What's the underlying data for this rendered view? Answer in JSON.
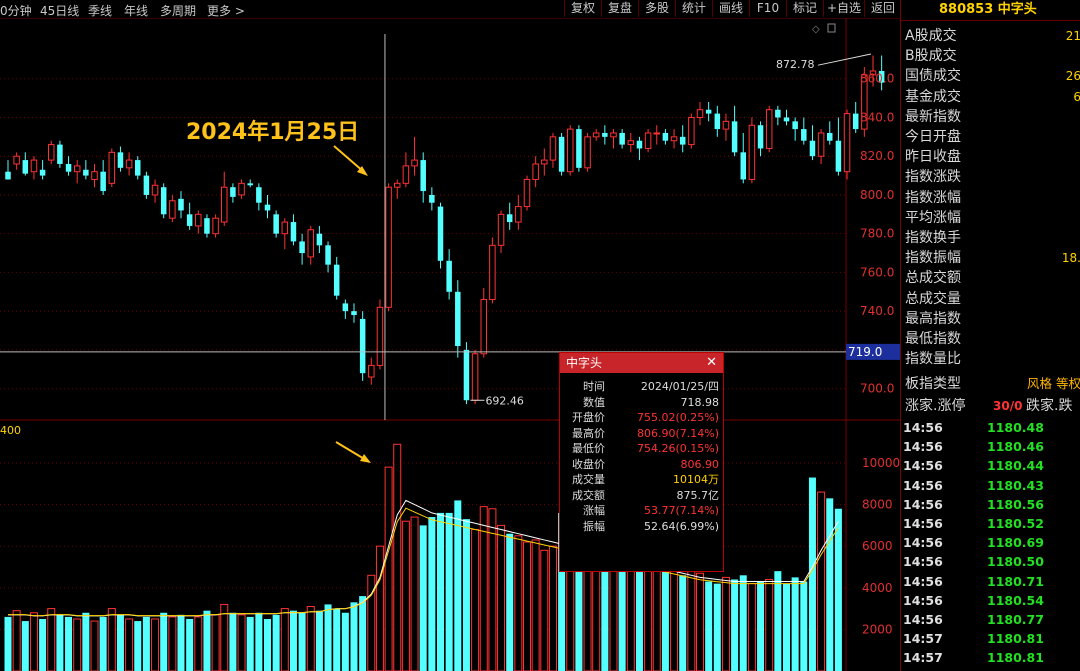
{
  "toolbar": {
    "left_items": [
      "0分钟",
      "45日线",
      "季线",
      "年线",
      "多周期",
      "更多 >"
    ],
    "right_buttons": [
      "复权",
      "复盘",
      "多股",
      "统计",
      "画线",
      "F10",
      "标记",
      "+自选",
      "返回"
    ]
  },
  "chart": {
    "price_ticks": [
      "860.0",
      "840.0",
      "820.0",
      "800.0",
      "780.0",
      "760.0",
      "740.0",
      "720.0",
      "700.0"
    ],
    "volume_ticks": [
      "10000",
      "8000",
      "6000",
      "4000",
      "2000"
    ],
    "crosshair_value": "719.0",
    "max_label": "872.78",
    "min_label": "692.46",
    "annotation": "2024年1月25日",
    "volume_header": "400"
  },
  "popup": {
    "title": "中字头",
    "close": "✕",
    "rows": [
      {
        "label": "时间",
        "value": "2024/01/25/四",
        "color": "#dddddd"
      },
      {
        "label": "数值",
        "value": "718.98",
        "color": "#dddddd"
      },
      {
        "label": "开盘价",
        "value": "755.02(0.25%)",
        "color": "#ff3333"
      },
      {
        "label": "最高价",
        "value": "806.90(7.14%)",
        "color": "#ff3333"
      },
      {
        "label": "最低价",
        "value": "754.26(0.15%)",
        "color": "#ff3333"
      },
      {
        "label": "收盘价",
        "value": "806.90",
        "color": "#ff3333"
      },
      {
        "label": "成交量",
        "value": "10104万",
        "color": "#ffd200"
      },
      {
        "label": "成交额",
        "value": "875.7亿",
        "color": "#dddddd"
      },
      {
        "label": "涨幅",
        "value": "53.77(7.14%)",
        "color": "#ff3333"
      },
      {
        "label": "振幅",
        "value": "52.64(6.99%)",
        "color": "#dddddd"
      }
    ]
  },
  "side": {
    "header": "880853 中字头",
    "info": [
      {
        "label": "A股成交",
        "value": "21"
      },
      {
        "label": "B股成交",
        "value": ""
      },
      {
        "label": "国债成交",
        "value": "26"
      },
      {
        "label": "基金成交",
        "value": "6"
      },
      {
        "label": "最新指数",
        "value": ""
      },
      {
        "label": "今日开盘",
        "value": ""
      },
      {
        "label": "昨日收盘",
        "value": ""
      },
      {
        "label": "指数涨跌",
        "value": ""
      },
      {
        "label": "指数涨幅",
        "value": ""
      },
      {
        "label": "平均涨幅",
        "value": ""
      },
      {
        "label": "指数换手",
        "value": ""
      },
      {
        "label": "指数振幅",
        "value": "18."
      },
      {
        "label": "总成交额",
        "value": ""
      },
      {
        "label": "总成交量",
        "value": ""
      },
      {
        "label": "最高指数",
        "value": ""
      },
      {
        "label": "最低指数",
        "value": ""
      },
      {
        "label": "指数量比",
        "value": ""
      }
    ],
    "board_type_label": "板指类型",
    "board_type_value": "风格 等权",
    "limit_label": "涨家.涨停",
    "limit_value": "30/0",
    "limit_right": "跌家.跌",
    "ticks": [
      {
        "time": "14:56",
        "price": "1180.48"
      },
      {
        "time": "14:56",
        "price": "1180.46"
      },
      {
        "time": "14:56",
        "price": "1180.44"
      },
      {
        "time": "14:56",
        "price": "1180.43"
      },
      {
        "time": "14:56",
        "price": "1180.56"
      },
      {
        "time": "14:56",
        "price": "1180.52"
      },
      {
        "time": "14:56",
        "price": "1180.69"
      },
      {
        "time": "14:56",
        "price": "1180.50"
      },
      {
        "time": "14:56",
        "price": "1180.71"
      },
      {
        "time": "14:56",
        "price": "1180.54"
      },
      {
        "time": "14:56",
        "price": "1180.77"
      },
      {
        "time": "14:57",
        "price": "1180.81"
      },
      {
        "time": "14:57",
        "price": "1180.81"
      }
    ]
  },
  "chart_data": {
    "type": "candlestick",
    "ylim": [
      690,
      880
    ],
    "vol_ylim": [
      0,
      11200
    ],
    "candles": [
      [
        812,
        818,
        808,
        808
      ],
      [
        816,
        822,
        813,
        820
      ],
      [
        818,
        822,
        810,
        811
      ],
      [
        812,
        820,
        808,
        818
      ],
      [
        813,
        818,
        808,
        810
      ],
      [
        818,
        828,
        816,
        826
      ],
      [
        826,
        828,
        814,
        816
      ],
      [
        816,
        820,
        810,
        812
      ],
      [
        812,
        818,
        806,
        815
      ],
      [
        813,
        818,
        808,
        810
      ],
      [
        808,
        816,
        804,
        812
      ],
      [
        812,
        818,
        800,
        802
      ],
      [
        806,
        824,
        804,
        822
      ],
      [
        822,
        825,
        812,
        814
      ],
      [
        814,
        822,
        810,
        818
      ],
      [
        818,
        820,
        808,
        810
      ],
      [
        810,
        812,
        798,
        800
      ],
      [
        800,
        808,
        796,
        805
      ],
      [
        804,
        806,
        788,
        790
      ],
      [
        788,
        800,
        786,
        797
      ],
      [
        798,
        802,
        788,
        792
      ],
      [
        790,
        796,
        782,
        784
      ],
      [
        784,
        792,
        780,
        790
      ],
      [
        788,
        790,
        778,
        780
      ],
      [
        780,
        790,
        778,
        788
      ],
      [
        786,
        812,
        784,
        804
      ],
      [
        804,
        806,
        796,
        799
      ],
      [
        800,
        808,
        798,
        806
      ],
      [
        806,
        808,
        804,
        805
      ],
      [
        804,
        806,
        792,
        796
      ],
      [
        795,
        800,
        788,
        792
      ],
      [
        790,
        792,
        778,
        780
      ],
      [
        780,
        788,
        772,
        786
      ],
      [
        786,
        790,
        774,
        776
      ],
      [
        776,
        780,
        764,
        770
      ],
      [
        768,
        784,
        764,
        782
      ],
      [
        780,
        784,
        770,
        774
      ],
      [
        774,
        776,
        760,
        764
      ],
      [
        764,
        768,
        746,
        748
      ],
      [
        744,
        746,
        736,
        740
      ],
      [
        740,
        744,
        734,
        738
      ],
      [
        736,
        740,
        704,
        708
      ],
      [
        706,
        716,
        702,
        712
      ],
      [
        712,
        746,
        710,
        742
      ],
      [
        742,
        806,
        740,
        804
      ],
      [
        804,
        808,
        798,
        806
      ],
      [
        806,
        822,
        804,
        815
      ],
      [
        815,
        830,
        810,
        818
      ],
      [
        818,
        822,
        796,
        802
      ],
      [
        800,
        804,
        792,
        796
      ],
      [
        794,
        796,
        762,
        766
      ],
      [
        766,
        772,
        746,
        750
      ],
      [
        750,
        756,
        716,
        722
      ],
      [
        720,
        724,
        692,
        694
      ],
      [
        694,
        720,
        692,
        718
      ],
      [
        718,
        752,
        716,
        746
      ],
      [
        746,
        778,
        744,
        774
      ],
      [
        774,
        792,
        770,
        790
      ],
      [
        790,
        796,
        782,
        786
      ],
      [
        786,
        800,
        782,
        794
      ],
      [
        794,
        810,
        792,
        808
      ],
      [
        808,
        820,
        804,
        816
      ],
      [
        816,
        824,
        810,
        818
      ],
      [
        818,
        832,
        814,
        830
      ],
      [
        830,
        832,
        810,
        812
      ],
      [
        812,
        836,
        810,
        834
      ],
      [
        834,
        836,
        812,
        814
      ],
      [
        814,
        832,
        812,
        830
      ],
      [
        830,
        834,
        828,
        832
      ],
      [
        832,
        836,
        826,
        830
      ],
      [
        830,
        834,
        824,
        832
      ],
      [
        832,
        834,
        824,
        826
      ],
      [
        826,
        832,
        822,
        828
      ],
      [
        828,
        830,
        818,
        824
      ],
      [
        824,
        834,
        822,
        832
      ],
      [
        832,
        836,
        826,
        832
      ],
      [
        832,
        834,
        826,
        828
      ],
      [
        828,
        834,
        824,
        830
      ],
      [
        830,
        836,
        822,
        826
      ],
      [
        826,
        842,
        824,
        840
      ],
      [
        840,
        848,
        836,
        844
      ],
      [
        844,
        848,
        838,
        842
      ],
      [
        842,
        846,
        830,
        834
      ],
      [
        834,
        842,
        828,
        838
      ],
      [
        838,
        846,
        820,
        822
      ],
      [
        822,
        832,
        806,
        808
      ],
      [
        808,
        840,
        806,
        836
      ],
      [
        836,
        838,
        820,
        824
      ],
      [
        824,
        846,
        822,
        844
      ],
      [
        844,
        846,
        836,
        840
      ],
      [
        840,
        844,
        836,
        838
      ],
      [
        838,
        840,
        828,
        834
      ],
      [
        834,
        840,
        826,
        828
      ],
      [
        828,
        836,
        818,
        820
      ],
      [
        820,
        834,
        816,
        832
      ],
      [
        832,
        838,
        826,
        828
      ],
      [
        828,
        840,
        810,
        812
      ],
      [
        812,
        844,
        808,
        842
      ],
      [
        842,
        848,
        832,
        834
      ],
      [
        834,
        866,
        830,
        862
      ],
      [
        862,
        872,
        856,
        864
      ],
      [
        864,
        872,
        854,
        858
      ]
    ],
    "volumes": [
      2600,
      2900,
      2400,
      2800,
      2500,
      3000,
      2700,
      2600,
      2500,
      2800,
      2400,
      2600,
      3000,
      2700,
      2500,
      2400,
      2600,
      2500,
      2800,
      2600,
      2700,
      2500,
      2600,
      2900,
      2700,
      3200,
      2800,
      2700,
      2600,
      2800,
      2500,
      2700,
      3000,
      2900,
      2800,
      3100,
      2900,
      3200,
      3000,
      2800,
      3300,
      3600,
      4600,
      6000,
      9800,
      10900,
      7200,
      7400,
      7000,
      7400,
      7600,
      7600,
      8200,
      7300,
      6800,
      7900,
      7800,
      7000,
      6600,
      6500,
      6200,
      6300,
      5800,
      6000,
      7600,
      6800,
      6400,
      5800,
      6100,
      6000,
      5600,
      5800,
      6200,
      6000,
      5500,
      5300,
      5000,
      4800,
      4600,
      4900,
      4700,
      4300,
      4200,
      4500,
      4400,
      4600,
      4200,
      4300,
      4400,
      4800,
      4200,
      4500,
      4300,
      9300,
      8600,
      8300,
      7800
    ],
    "ma_vol": [
      2700,
      2700,
      2700,
      2650,
      2650,
      2700,
      2700,
      2700,
      2650,
      2650,
      2650,
      2650,
      2700,
      2700,
      2700,
      2650,
      2650,
      2650,
      2650,
      2650,
      2650,
      2650,
      2650,
      2700,
      2700,
      2750,
      2750,
      2750,
      2750,
      2750,
      2750,
      2750,
      2800,
      2800,
      2800,
      2850,
      2850,
      2950,
      3000,
      3000,
      3100,
      3300,
      3700,
      4500,
      6000,
      7500,
      8200,
      8000,
      7800,
      7600,
      7500,
      7400,
      7300,
      7200,
      7100,
      7000,
      6900,
      6800,
      6700,
      6600,
      6500,
      6400,
      6300,
      6200,
      6100,
      6000,
      5900,
      5800,
      5700,
      5600,
      5500,
      5400,
      5300,
      5200,
      5100,
      5000,
      4900,
      4800,
      4700,
      4600,
      4500,
      4450,
      4400,
      4350,
      4300,
      4300,
      4300,
      4300,
      4300,
      4300,
      4300,
      4300,
      4300,
      5000,
      5800,
      6500,
      7200
    ]
  }
}
